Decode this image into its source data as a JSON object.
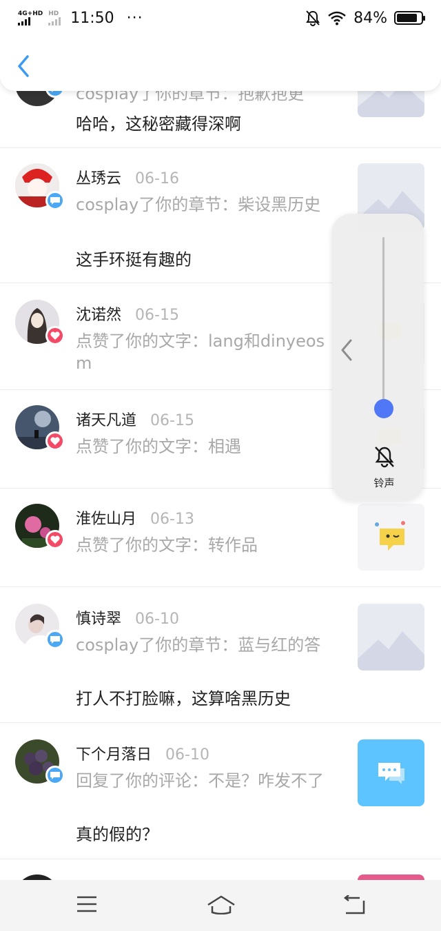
{
  "status_bar": {
    "network_1": "4G+HD",
    "network_2": "HD",
    "time": "11:50",
    "more": "···",
    "battery": "84%",
    "battery_fraction": 0.84
  },
  "icons": {
    "back": "chevron-left-icon",
    "mute": "bell-off-icon",
    "wifi": "wifi-icon",
    "comment_badge": "comment-bubble-icon",
    "like_badge": "heart-icon"
  },
  "notifications": [
    {
      "name": "",
      "date": "",
      "action": "cosplay了你的章节：抱歉抱更",
      "reply": "哈哈，这秘密藏得深啊",
      "badge": "comment",
      "thumb": "landscape"
    },
    {
      "name": "丛琇云",
      "date": "06-16",
      "action": "cosplay了你的章节：柴设黑历史",
      "reply": "这手环挺有趣的",
      "badge": "comment",
      "thumb": "landscape"
    },
    {
      "name": "沈诺然",
      "date": "06-15",
      "action": "点赞了你的文字：lang和dinyeosm",
      "reply": "",
      "badge": "like",
      "thumb": "emoji"
    },
    {
      "name": "诸天凡道",
      "date": "06-15",
      "action": "点赞了你的文字：相遇",
      "reply": "",
      "badge": "like",
      "thumb": "emoji"
    },
    {
      "name": "淮佐山月",
      "date": "06-13",
      "action": "点赞了你的文字：转作品",
      "reply": "",
      "badge": "like",
      "thumb": "emoji"
    },
    {
      "name": "慎诗翠",
      "date": "06-10",
      "action": "cosplay了你的章节：蓝与红的答",
      "reply": "打人不打脸嘛，这算啥黑历史",
      "badge": "comment",
      "thumb": "landscape"
    },
    {
      "name": "下个月落日",
      "date": "06-10",
      "action": "回复了你的评论：不是？咋发不了",
      "reply": "真的假的？",
      "badge": "comment",
      "thumb": "chat"
    }
  ],
  "volume": {
    "label": "铃声",
    "level": 0.05
  },
  "colors": {
    "accent_blue": "#4aa8f5",
    "like_red": "#f24a67",
    "slider_blue": "#4b73f5",
    "chat_thumb": "#5ec4ff"
  }
}
